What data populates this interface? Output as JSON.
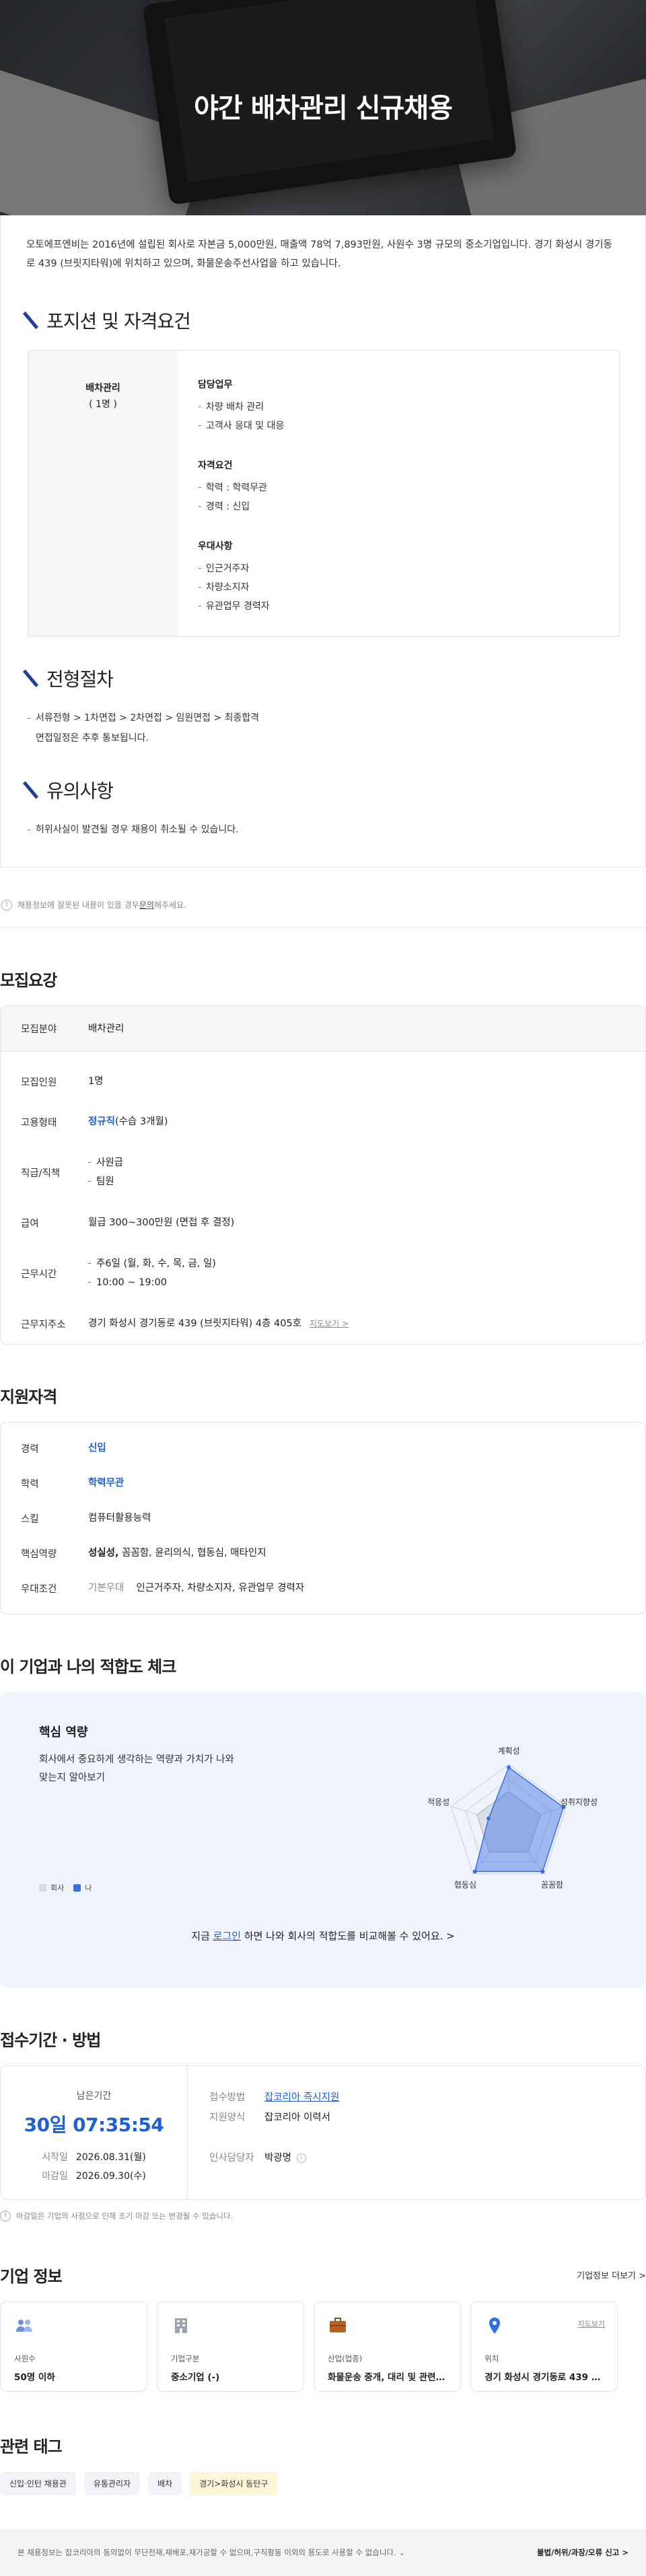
{
  "hero": {
    "title": "야간 배차관리 신규채용"
  },
  "intro": "오토에프엔비는 2016년에 설립된 회사로 자본금 5,000만원, 매출액 78억 7,893만원, 사원수 3명 규모의 중소기업입니다. 경기 화성시 경기동로 439 (브릿지타워)에 위치하고 있으며, 화물운송주선사업을 하고 있습니다.",
  "position": {
    "title": "포지션 및 자격요건",
    "role": "배차관리",
    "count": "( 1명 )",
    "groups": [
      {
        "title": "담당업무",
        "items": [
          "차량 배차 관리",
          "고객사 응대 및 대응"
        ]
      },
      {
        "title": "자격요건",
        "items": [
          "학력 : 학력무관",
          "경력 : 신입"
        ]
      },
      {
        "title": "우대사항",
        "items": [
          "인근거주자",
          "차량소지자",
          "유관업무 경력자"
        ]
      }
    ]
  },
  "process": {
    "title": "전형절차",
    "line1": "서류전형 > 1차면접 > 2차면접 > 임원면접 > 최종합격",
    "line2": "면접일정은 추후 통보됩니다."
  },
  "caution": {
    "title": "유의사항",
    "line1": "허위사실이 발견될 경우 채용이 취소될 수 있습니다."
  },
  "notice": {
    "text1": "채용정보에 잘못된 내용이 있을 경우 ",
    "link": "문의",
    "text2": "해주세요."
  },
  "recruit": {
    "title": "모집요강",
    "rows": [
      {
        "k": "모집분야",
        "v": "배차관리"
      },
      {
        "k": "모집인원",
        "v": "1명"
      },
      {
        "k": "고용형태",
        "v_blue": "정규직",
        "v": "(수습 3개월)"
      },
      {
        "k": "직급/직책",
        "list": [
          "사원급",
          "팀원"
        ]
      },
      {
        "k": "급여",
        "v": "월급 300~300만원 (면접 후 결정)"
      },
      {
        "k": "근무시간",
        "list": [
          "주6일 (월, 화, 수, 목, 금, 일)",
          "10:00 ~ 19:00"
        ]
      },
      {
        "k": "근무지주소",
        "v": "경기 화성시 경기동로 439 (브릿지타워) 4층 405호",
        "link": "지도보기 >"
      }
    ]
  },
  "qual": {
    "title": "지원자격",
    "rows": [
      {
        "k": "경력",
        "v_blue": "신입"
      },
      {
        "k": "학력",
        "v_blue": "학력무관"
      },
      {
        "k": "스킬",
        "v": "컴퓨터활용능력"
      },
      {
        "k": "핵심역량",
        "v_bold": "성실성,",
        "v": " 꼼꼼함, 윤리의식, 협동심, 매타인지"
      },
      {
        "k": "우대조건",
        "v_gray": "기본우대",
        "v": "인근거주자, 차량소지자, 유관업무 경력자"
      }
    ]
  },
  "fit": {
    "title": "이 기업과 나의 적합도 체크",
    "card_title": "핵심 역량",
    "desc": "회사에서 중요하게 생각하는 역량과 가치가 나와 맞는지 알아보기",
    "legend_company": "회사",
    "legend_me": "나",
    "axes": [
      "계획성",
      "성취지향성",
      "꼼꼼함",
      "협동심",
      "적응성"
    ],
    "company_values": [
      0.55,
      0.55,
      0.55,
      0.55,
      0.55
    ],
    "my_values": [
      0.95,
      0.95,
      0.95,
      0.95,
      0.35
    ],
    "company_color": "#d6dbe3",
    "my_color": "#3a6fe0",
    "cta_pre": "지금 ",
    "cta_link": "로그인",
    "cta_post": " 하면 나와 회사의 적합도를 비교해볼 수 있어요. >"
  },
  "apply": {
    "title": "접수기간 · 방법",
    "remain_label": "남은기간",
    "remain": "30일 07:35:54",
    "start_k": "시작일",
    "start_v": "2026.08.31(월)",
    "end_k": "마감일",
    "end_v": "2026.09.30(수)",
    "method_k": "접수방법",
    "method_v": "잡코리아 즉시지원",
    "form_k": "지원양식",
    "form_v": "잡코리아 이력서",
    "hr_k": "인사담당자",
    "hr_v": "박광명",
    "notice": "마감일은 기업의 사정으로 인해 조기 마감 또는 변경될 수 있습니다."
  },
  "company": {
    "title": "기업 정보",
    "more": "기업정보 더보기 >",
    "cards": [
      {
        "icon": "people-icon",
        "t": "사원수",
        "v": "50명 이하"
      },
      {
        "icon": "building-icon",
        "t": "기업구분",
        "v": "중소기업 (-)"
      },
      {
        "icon": "briefcase-icon",
        "t": "산업(업종)",
        "v": "화물운송 중개, 대리 및 관련 서비..."
      },
      {
        "icon": "location-icon",
        "t": "위치",
        "v": "경기 화성시 경기동로 439 (브릿...",
        "link": "지도보기"
      }
    ]
  },
  "tags": {
    "title": "관련 태그",
    "items": [
      "신입·인턴 채용관",
      "유통관리자",
      "배차",
      "경기>화성시 동탄구"
    ]
  },
  "footer": {
    "left": "본 채용정보는 잡코리아의 동의없이 무단전재,재배포,재가공할 수 없으며,구직활동 이외의 용도로 사용할 수 없습니다. ⌄",
    "right": "불법/허위/과장/오류 신고 >"
  }
}
